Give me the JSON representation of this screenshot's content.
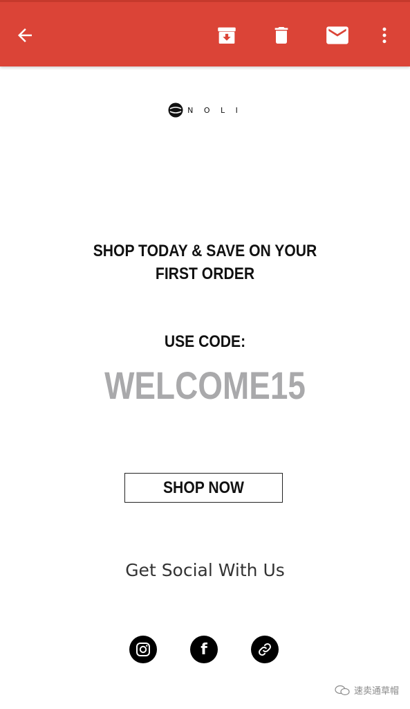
{
  "toolbar": {
    "back_icon": "arrow-left-icon",
    "archive_icon": "archive-icon",
    "delete_icon": "trash-icon",
    "mark_unread_icon": "mail-icon",
    "more_icon": "more-vert-icon",
    "accent_color": "#db4437"
  },
  "email": {
    "logo_text": "N O L I",
    "headline_line1": "SHOP TODAY & SAVE ON YOUR",
    "headline_line2": "FIRST ORDER",
    "use_code_label": "USE CODE:",
    "promo_code": "WELCOME15",
    "promo_code_color": "#a9a9ab",
    "cta_label": "SHOP NOW",
    "social_title": "Get Social With Us",
    "social_links": [
      {
        "icon": "instagram-icon"
      },
      {
        "icon": "facebook-icon",
        "glyph": "f"
      },
      {
        "icon": "link-icon"
      }
    ]
  },
  "watermark": {
    "text": "速卖通草帽"
  }
}
